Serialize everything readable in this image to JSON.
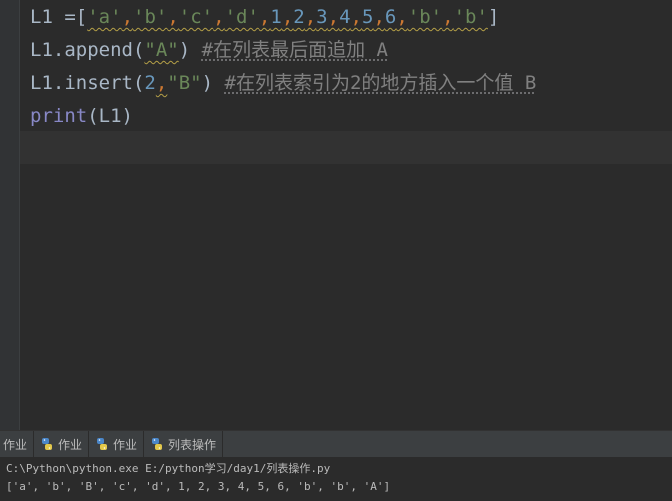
{
  "editor": {
    "lines": {
      "l1": {
        "name": "L1",
        "assign": " =",
        "open": "[",
        "s1": "'a'",
        "c1": ",",
        "s2": "'b'",
        "c2": ",",
        "s3": "'c'",
        "c3": ",",
        "s4": "'d'",
        "c4": ",",
        "n1": "1",
        "c5": ",",
        "n2": "2",
        "c6": ",",
        "n3": "3",
        "c7": ",",
        "n4": "4",
        "c8": ",",
        "n5": "5",
        "c9": ",",
        "n6": "6",
        "c10": ",",
        "s5": "'b'",
        "c11": ",",
        "s6": "'b'",
        "close": "]"
      },
      "l2": {
        "prefix": "L1.append(",
        "arg": "\"A\"",
        "suffix": ")",
        "comment": "#在列表最后面追加 A"
      },
      "l3": {
        "prefix": "L1.insert(",
        "num": "2",
        "comma": ",",
        "arg": "\"B\"",
        "suffix": ")",
        "comment": "#在列表索引为2的地方插入一个值 B"
      },
      "l4": {
        "fn": "print",
        "args": "(L1)"
      }
    }
  },
  "tool_tabs": [
    {
      "label": "作业"
    },
    {
      "label": "作业"
    },
    {
      "label": "作业"
    },
    {
      "label": "列表操作"
    }
  ],
  "console": {
    "command": "C:\\Python\\python.exe E:/python学习/day1/列表操作.py",
    "output": "['a', 'b', 'B', 'c', 'd', 1, 2, 3, 4, 5, 6, 'b', 'b', 'A']"
  },
  "colors": {
    "background": "#2b2b2b",
    "string": "#6a8759",
    "number": "#6897bb",
    "comment": "#808080",
    "builtin": "#8888c6",
    "default_text": "#a9b7c6"
  }
}
